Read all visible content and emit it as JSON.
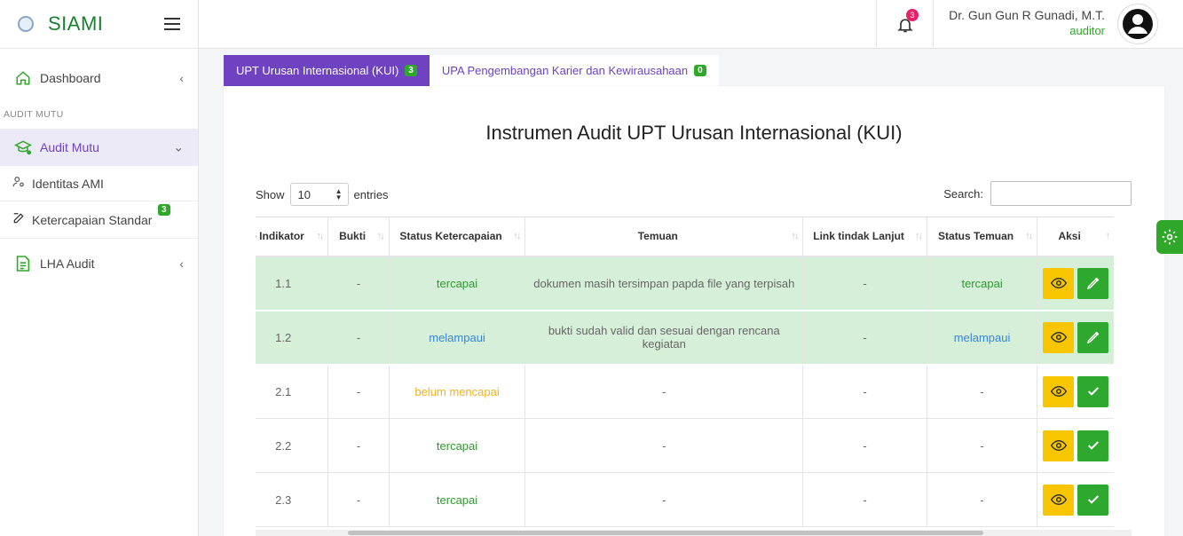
{
  "app": {
    "name": "SIAMI"
  },
  "sidebar": {
    "dashboard": "Dashboard",
    "section_label": "AUDIT MUTU",
    "audit_mutu": "Audit Mutu",
    "identitas": "Identitas AMI",
    "ketercapaian": "Ketercapaian Standar",
    "ketercapaian_badge": "3",
    "lha": "LHA Audit"
  },
  "header": {
    "notif_count": "3",
    "user_name": "Dr. Gun Gun R Gunadi, M.T.",
    "user_role": "auditor"
  },
  "tabs": [
    {
      "label": "UPT Urusan Internasional (KUI)",
      "badge": "3"
    },
    {
      "label": "UPA Pengembangan Karier dan Kewirausahaan",
      "badge": "0"
    }
  ],
  "card": {
    "title": "Instrumen Audit UPT Urusan Internasional (KUI)",
    "show_label": "Show",
    "entries_value": "10",
    "entries_label": "entries",
    "search_label": "Search:"
  },
  "table": {
    "headers": [
      "o Indikator",
      "Bukti",
      "Status Ketercapaian",
      "Temuan",
      "Link tindak Lanjut",
      "Status Temuan",
      "Aksi"
    ],
    "rows": [
      {
        "indikator": "1.1",
        "bukti": "-",
        "status": "tercapai",
        "temuan": "dokumen masih tersimpan papda file yang terpisah",
        "link": "-",
        "status_temuan": "tercapai"
      },
      {
        "indikator": "1.2",
        "bukti": "-",
        "status": "melampaui",
        "temuan": "bukti sudah valid dan sesuai dengan rencana kegiatan",
        "link": "-",
        "status_temuan": "melampaui"
      },
      {
        "indikator": "2.1",
        "bukti": "-",
        "status": "belum mencapai",
        "temuan": "-",
        "link": "-",
        "status_temuan": "-"
      },
      {
        "indikator": "2.2",
        "bukti": "-",
        "status": "tercapai",
        "temuan": "-",
        "link": "-",
        "status_temuan": "-"
      },
      {
        "indikator": "2.3",
        "bukti": "-",
        "status": "tercapai",
        "temuan": "-",
        "link": "-",
        "status_temuan": "-"
      }
    ]
  },
  "colors": {
    "brand_green": "#2fa82a",
    "tab_purple": "#6f42c1",
    "highlight_row": "#d6efd9",
    "view_button": "#f7c600",
    "edit_button": "#2ea82e"
  }
}
